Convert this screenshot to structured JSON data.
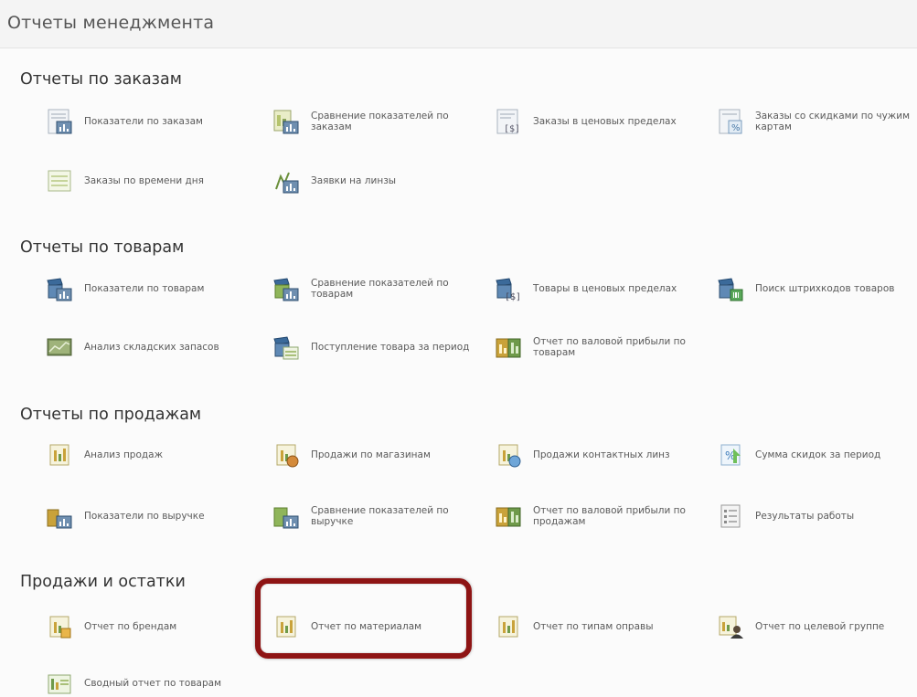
{
  "page": {
    "title": "Отчеты менеджмента"
  },
  "sections": [
    {
      "title": "Отчеты по заказам",
      "items": [
        {
          "label": "Показатели по заказам",
          "icon": "orders-report-icon"
        },
        {
          "label": "Сравнение показателей по заказам",
          "icon": "orders-compare-icon"
        },
        {
          "label": "Заказы в ценовых пределах",
          "icon": "orders-price-range-icon"
        },
        {
          "label": "Заказы со скидками по чужим картам",
          "icon": "orders-discount-icon"
        },
        {
          "label": "Заказы по времени дня",
          "icon": "orders-time-icon"
        },
        {
          "label": "Заявки на линзы",
          "icon": "lens-requests-icon"
        }
      ]
    },
    {
      "title": "Отчеты по товарам",
      "items": [
        {
          "label": "Показатели по товарам",
          "icon": "goods-report-icon"
        },
        {
          "label": "Сравнение показателей по товарам",
          "icon": "goods-compare-icon"
        },
        {
          "label": "Товары в ценовых пределах",
          "icon": "goods-price-range-icon"
        },
        {
          "label": "Поиск штрихкодов товаров",
          "icon": "barcode-search-icon"
        },
        {
          "label": "Анализ складских запасов",
          "icon": "stock-analysis-icon"
        },
        {
          "label": "Поступление товара за период",
          "icon": "goods-arrival-icon"
        },
        {
          "label": "Отчет по валовой прибыли по товарам",
          "icon": "gross-profit-goods-icon"
        }
      ]
    },
    {
      "title": "Отчеты по продажам",
      "items": [
        {
          "label": "Анализ продаж",
          "icon": "sales-analysis-icon"
        },
        {
          "label": "Продажи по магазинам",
          "icon": "store-sales-icon"
        },
        {
          "label": "Продажи контактных линз",
          "icon": "contact-lens-sales-icon"
        },
        {
          "label": "Сумма скидок за период",
          "icon": "discount-sum-icon"
        },
        {
          "label": "Показатели по выручке",
          "icon": "revenue-report-icon"
        },
        {
          "label": "Сравнение показателей по выручке",
          "icon": "revenue-compare-icon"
        },
        {
          "label": "Отчет по валовой прибыли по продажам",
          "icon": "gross-profit-sales-icon"
        },
        {
          "label": "Результаты работы",
          "icon": "work-results-icon"
        }
      ]
    },
    {
      "title": "Продажи и остатки",
      "items": [
        {
          "label": "Отчет по брендам",
          "icon": "brands-report-icon"
        },
        {
          "label": "Отчет по материалам",
          "icon": "materials-report-icon"
        },
        {
          "label": "Отчет по типам оправы",
          "icon": "frame-types-report-icon"
        },
        {
          "label": "Отчет по целевой группе",
          "icon": "target-group-report-icon"
        },
        {
          "label": "Сводный отчет по товарам",
          "icon": "goods-summary-report-icon"
        }
      ]
    }
  ]
}
